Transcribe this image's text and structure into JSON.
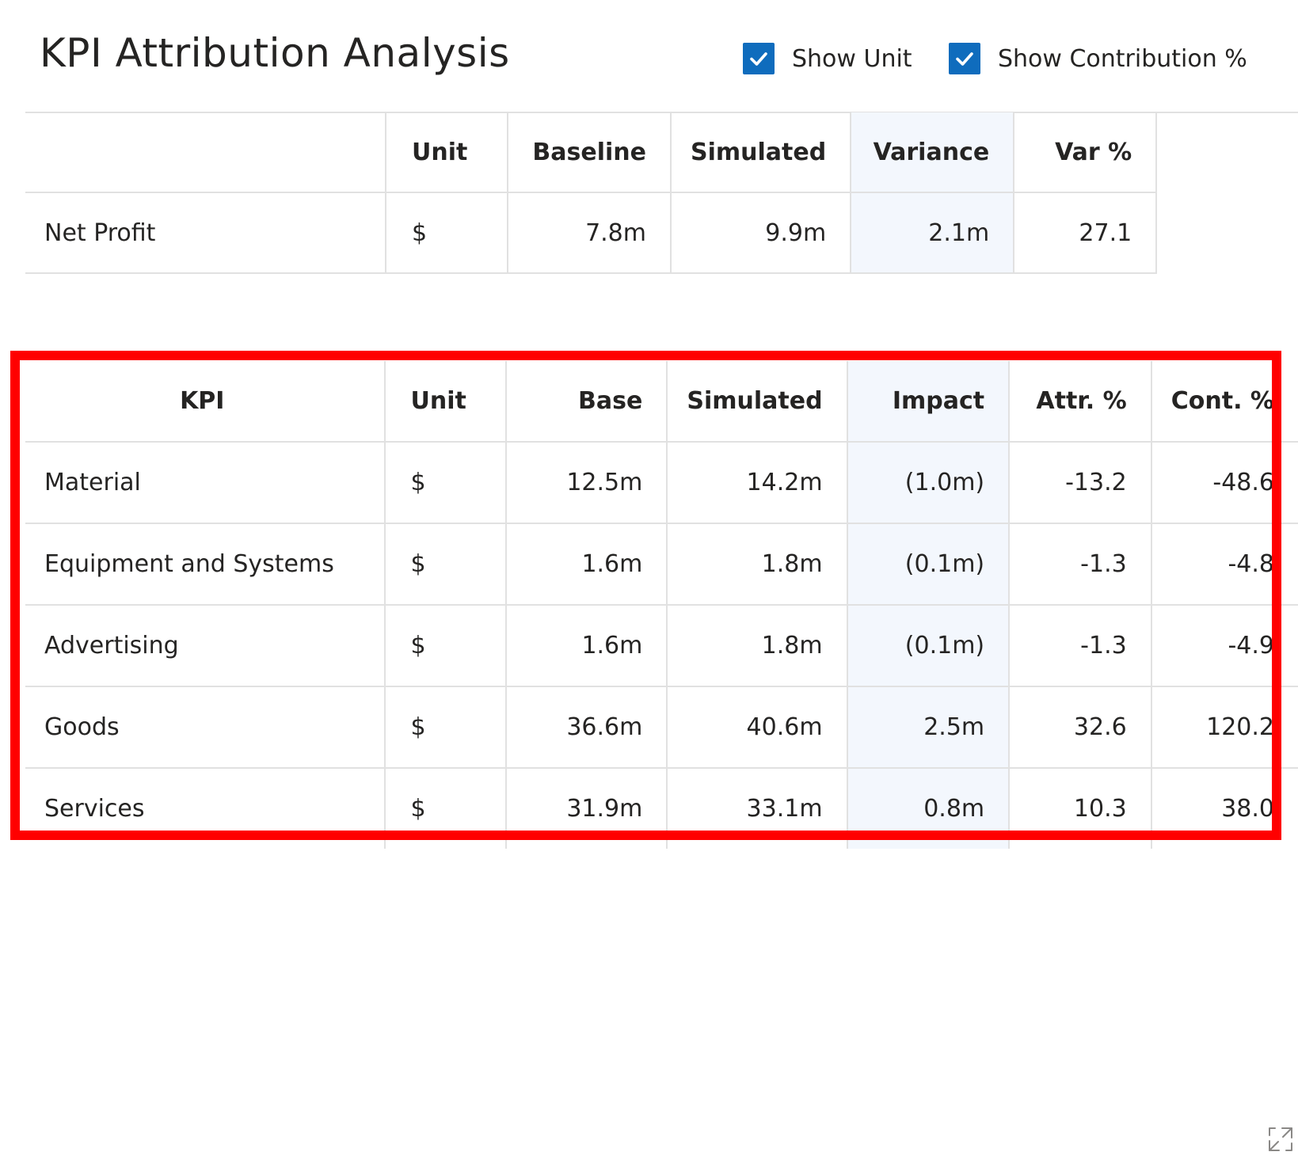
{
  "header": {
    "title": "KPI Attribution Analysis",
    "toggles": [
      {
        "label": "Show Unit",
        "checked": true
      },
      {
        "label": "Show Contribution %",
        "checked": true
      }
    ],
    "accent_color": "#0f6cbd"
  },
  "summary_table": {
    "columns": [
      "",
      "Unit",
      "Baseline",
      "Simulated",
      "Variance",
      "Var %"
    ],
    "rows": [
      [
        "Net Profit",
        "$",
        "7.8m",
        "9.9m",
        "2.1m",
        "27.1"
      ]
    ]
  },
  "attribution_table": {
    "columns": [
      "KPI",
      "Unit",
      "Base",
      "Simulated",
      "Impact",
      "Attr. %",
      "Cont. %"
    ],
    "rows": [
      [
        "Material",
        "$",
        "12.5m",
        "14.2m",
        "(1.0m)",
        "-13.2",
        "-48.6"
      ],
      [
        "Equipment and Systems",
        "$",
        "1.6m",
        "1.8m",
        "(0.1m)",
        "-1.3",
        "-4.8"
      ],
      [
        "Advertising",
        "$",
        "1.6m",
        "1.8m",
        "(0.1m)",
        "-1.3",
        "-4.9"
      ],
      [
        "Goods",
        "$",
        "36.6m",
        "40.6m",
        "2.5m",
        "32.6",
        "120.2"
      ],
      [
        "Services",
        "$",
        "31.9m",
        "33.1m",
        "0.8m",
        "10.3",
        "38.0"
      ]
    ],
    "highlight_border_color": "#ff0000",
    "highlight_column_color": "#f3f7fd"
  },
  "icons": {
    "checkbox": "checkmark-icon",
    "expand": "expand-icon"
  }
}
